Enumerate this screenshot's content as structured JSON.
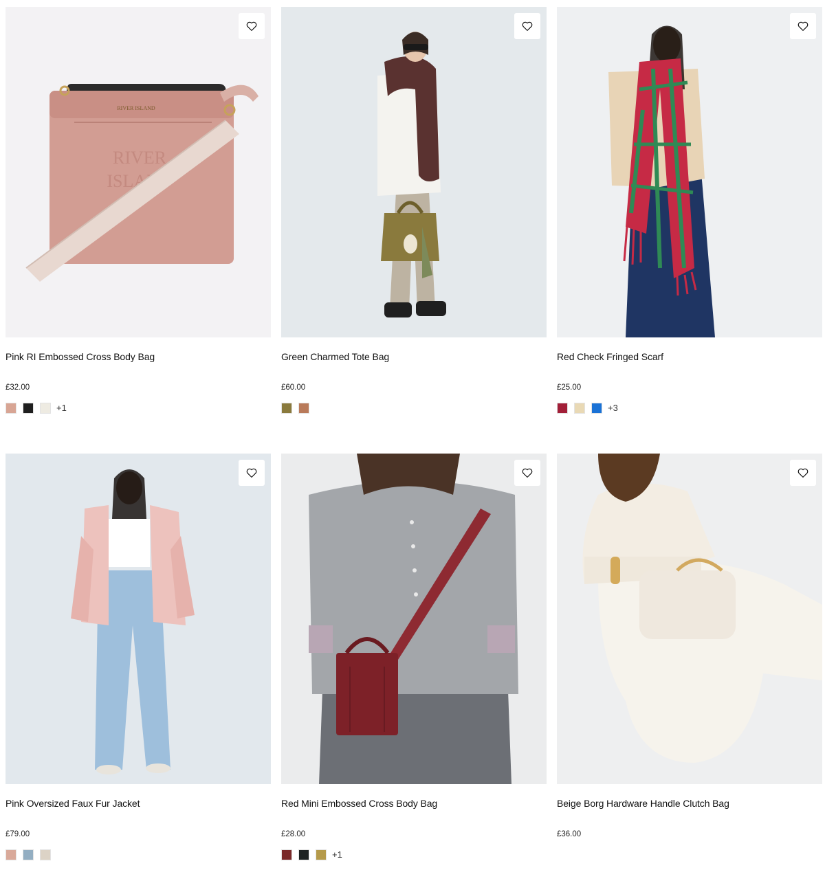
{
  "products": [
    {
      "name": "Pink RI Embossed Cross Body Bag",
      "price": "£32.00",
      "swatches": [
        "#d8a594",
        "#1f1f1f",
        "#eeebe2"
      ],
      "more": "+1",
      "bg": "#f3f2f4"
    },
    {
      "name": "Green Charmed Tote Bag",
      "price": "£60.00",
      "swatches": [
        "#8a7a3d",
        "#b97a5a"
      ],
      "more": "",
      "bg": "#e4e9ec"
    },
    {
      "name": "Red Check Fringed Scarf",
      "price": "£25.00",
      "swatches": [
        "#a21f38",
        "#e9d9b5",
        "#1a72d6"
      ],
      "more": "+3",
      "bg": "#eef0f2"
    },
    {
      "name": "Pink Oversized Faux Fur Jacket",
      "price": "£79.00",
      "swatches": [
        "#d9a99a",
        "#93aec2",
        "#dcd3c6"
      ],
      "more": "",
      "bg": "#e2e8ed"
    },
    {
      "name": "Red Mini Embossed Cross Body Bag",
      "price": "£28.00",
      "swatches": [
        "#7a2a2a",
        "#1d2222",
        "#b59a4a"
      ],
      "more": "+1",
      "bg": "#ebeced"
    },
    {
      "name": "Beige Borg Hardware Handle Clutch Bag",
      "price": "£36.00",
      "swatches": [],
      "more": "",
      "bg": "#eeeff0"
    }
  ],
  "icons": {
    "wishlist": "heart-outline-icon"
  }
}
